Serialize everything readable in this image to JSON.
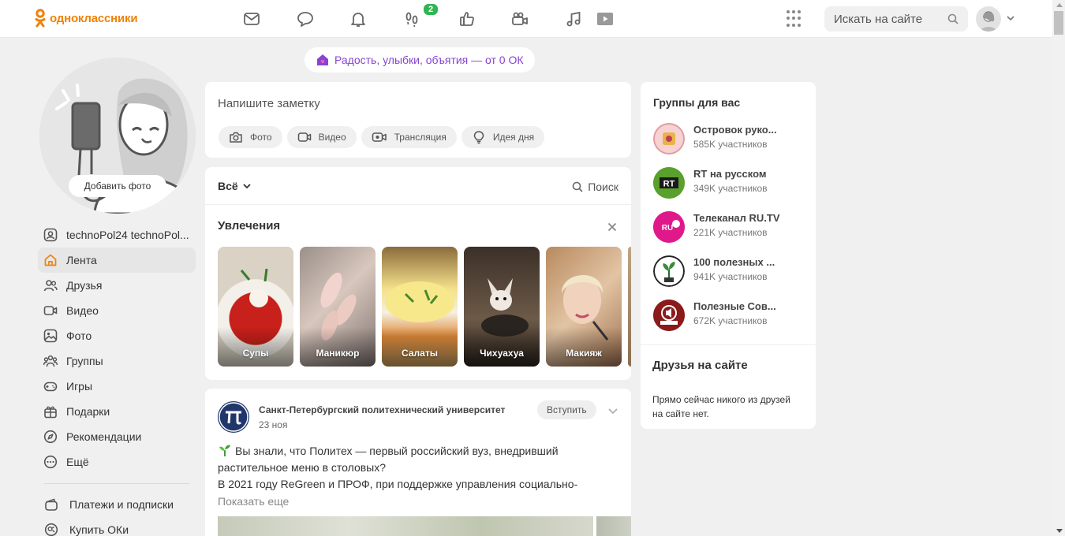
{
  "header": {
    "logo_text": "одноклассники",
    "notification_badge": "2",
    "search_placeholder": "Искать на сайте",
    "nav_icons": [
      "mail-icon",
      "chat-icon",
      "bell-icon",
      "guests-icon",
      "likes-icon",
      "video-camera-icon",
      "music-icon",
      "video-play-icon"
    ]
  },
  "promo": {
    "label": "Радость, улыбки, объятия — от 0 ОК"
  },
  "profile": {
    "add_photo_label": "Добавить фото"
  },
  "sidebar": {
    "items": [
      {
        "label": "technoPol24 technoPol...",
        "icon": "user-icon"
      },
      {
        "label": "Лента",
        "icon": "home-icon",
        "active": true
      },
      {
        "label": "Друзья",
        "icon": "friends-icon"
      },
      {
        "label": "Видео",
        "icon": "video-icon"
      },
      {
        "label": "Фото",
        "icon": "photo-icon"
      },
      {
        "label": "Группы",
        "icon": "groups-icon"
      },
      {
        "label": "Игры",
        "icon": "gamepad-icon"
      },
      {
        "label": "Подарки",
        "icon": "gift-icon"
      },
      {
        "label": "Рекомендации",
        "icon": "compass-icon"
      },
      {
        "label": "Ещё",
        "icon": "more-icon"
      }
    ],
    "extra_items": [
      {
        "label": "Платежи и подписки",
        "icon": "wallet-icon"
      },
      {
        "label": "Купить ОКи",
        "icon": "coin-icon"
      }
    ]
  },
  "composer": {
    "placeholder": "Напишите заметку",
    "buttons": [
      {
        "label": "Фото",
        "icon": "camera-icon"
      },
      {
        "label": "Видео",
        "icon": "video-icon"
      },
      {
        "label": "Трансляция",
        "icon": "broadcast-icon"
      },
      {
        "label": "Идея дня",
        "icon": "lightbulb-icon"
      }
    ]
  },
  "feed": {
    "filter_label": "Всё",
    "search_label": "Поиск",
    "hobbies_title": "Увлечения",
    "hobbies": [
      {
        "label": "Супы"
      },
      {
        "label": "Маникюр"
      },
      {
        "label": "Салаты"
      },
      {
        "label": "Чихуахуа"
      },
      {
        "label": "Макияж"
      }
    ]
  },
  "post": {
    "author": "Санкт-Петербургский политехнический университет",
    "date": "23 ноя",
    "join_label": "Вступить",
    "text_line1": "Вы знали, что Политех — первый российский вуз, внедривший растительное меню в столовых?",
    "text_line2": "В 2021 году ReGreen и ПРОФ, при поддержке управления социально-",
    "show_more": "Показать еще"
  },
  "groups": {
    "title": "Группы для вас",
    "items": [
      {
        "name": "Островок руко...",
        "members": "585K участников",
        "color": "#f3c5c5"
      },
      {
        "name": "RT на русском",
        "members": "349K участников",
        "color": "#5aa02c"
      },
      {
        "name": "Телеканал RU.TV",
        "members": "221K участников",
        "color": "#e0198a"
      },
      {
        "name": "100 полезных ...",
        "members": "941K участников",
        "color": "#ffffff"
      },
      {
        "name": "Полезные Сов...",
        "members": "672K участников",
        "color": "#8b1a1a"
      }
    ]
  },
  "friends": {
    "title": "Друзья на сайте",
    "empty_text": "Прямо сейчас никого из друзей на сайте нет."
  },
  "colors": {
    "brand_orange": "#ee8208",
    "badge_green": "#31b552",
    "promo_purple": "#8744d4",
    "background": "#f0f0f0"
  }
}
